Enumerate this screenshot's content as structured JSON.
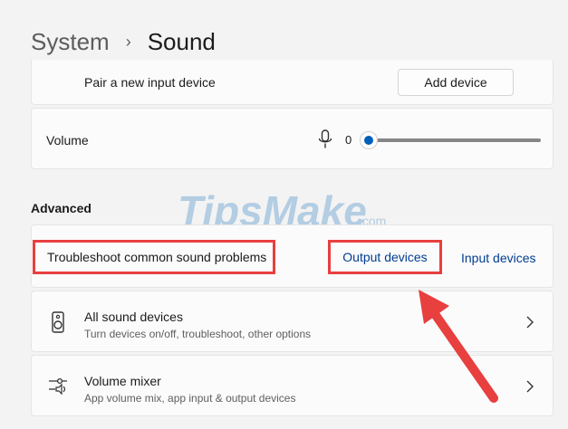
{
  "breadcrumb": {
    "parent": "System",
    "separator": "›",
    "current": "Sound"
  },
  "pair_input": {
    "label": "Pair a new input device",
    "button_label": "Add device"
  },
  "volume": {
    "label": "Volume",
    "value": "0",
    "level": 0
  },
  "advanced": {
    "title": "Advanced"
  },
  "troubleshoot": {
    "label": "Troubleshoot common sound problems",
    "output_link": "Output devices",
    "input_link": "Input devices"
  },
  "all_devices": {
    "title": "All sound devices",
    "subtitle": "Turn devices on/off, troubleshoot, other options",
    "icon": "speaker-icon"
  },
  "volume_mixer": {
    "title": "Volume mixer",
    "subtitle": "App volume mix, app input & output devices",
    "icon": "mixer-icon"
  },
  "watermark": {
    "text": "TipsMake",
    "suffix": ".com"
  },
  "colors": {
    "accent": "#005fb8",
    "link": "#003e92",
    "highlight": "#e83f3f",
    "watermark": "#3b86c7"
  }
}
